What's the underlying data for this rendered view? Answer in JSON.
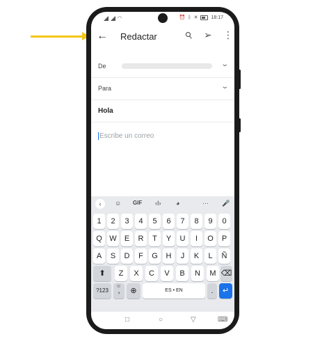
{
  "status": {
    "time": "18:17"
  },
  "compose": {
    "title": "Redactar",
    "from_label": "De",
    "to_label": "Para",
    "subject": "Hola",
    "body_placeholder": "Escribe un correo"
  },
  "keyboard": {
    "toolbar": {
      "gif": "GIF"
    },
    "row_numbers": [
      "1",
      "2",
      "3",
      "4",
      "5",
      "6",
      "7",
      "8",
      "9",
      "0"
    ],
    "row1": [
      "Q",
      "W",
      "E",
      "R",
      "T",
      "Y",
      "U",
      "I",
      "O",
      "P"
    ],
    "row2": [
      "A",
      "S",
      "D",
      "F",
      "G",
      "H",
      "J",
      "K",
      "L",
      "Ñ"
    ],
    "row3": [
      "Z",
      "X",
      "C",
      "V",
      "B",
      "N",
      "M"
    ],
    "symbols_key": "?123",
    "comma_key": ",",
    "space_label": "ES • EN",
    "period_key": "."
  },
  "colors": {
    "arrow": "#f5c518",
    "accent": "#1a73e8",
    "phone_frame": "#1b1b1b"
  }
}
